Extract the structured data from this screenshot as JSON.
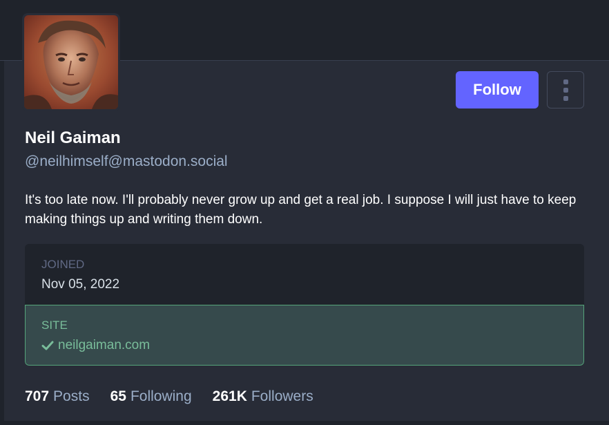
{
  "profile": {
    "display_name": "Neil Gaiman",
    "handle": "@neilhimself@mastodon.social",
    "bio": "It's too late now. I'll probably never grow up and get a real job. I suppose I will just have to keep making things up and writing them down.",
    "follow_label": "Follow",
    "menu_icon": "vertical-ellipsis-icon"
  },
  "fields": {
    "joined_label": "JOINED",
    "joined_value": "Nov 05, 2022",
    "site_label": "SITE",
    "site_value": "neilgaiman.com",
    "site_icon": "checkmark-icon"
  },
  "stats": {
    "posts_count": "707",
    "posts_label": "Posts",
    "following_count": "65",
    "following_label": "Following",
    "followers_count": "261K",
    "followers_label": "Followers"
  },
  "colors": {
    "accent": "#6364ff",
    "verified": "#79bd9a",
    "background": "#282c37",
    "muted_text": "#9baec8"
  }
}
